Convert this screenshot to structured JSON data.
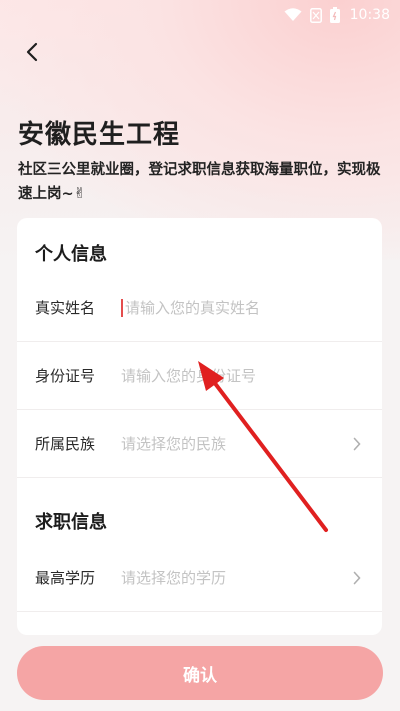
{
  "status_bar": {
    "time": "10:38",
    "icons": [
      "wifi-icon",
      "sim-icon",
      "battery-icon"
    ]
  },
  "nav": {
    "back_icon": "chevron-left-icon"
  },
  "header": {
    "title": "安徽民生工程",
    "subtitle": "社区三公里就业圈，登记求职信息获取海量职位，实现极速上岗~✌"
  },
  "personal_info": {
    "section_title": "个人信息",
    "fields": [
      {
        "label": "真实姓名",
        "placeholder": "请输入您的真实姓名",
        "type": "input"
      },
      {
        "label": "身份证号",
        "placeholder": "请输入您的身份证号",
        "type": "input"
      },
      {
        "label": "所属民族",
        "placeholder": "请选择您的民族",
        "type": "select"
      }
    ]
  },
  "job_info": {
    "section_title": "求职信息",
    "fields": [
      {
        "label": "最高学历",
        "placeholder": "请选择您的学历",
        "type": "select"
      }
    ]
  },
  "confirm": {
    "label": "确认"
  },
  "colors": {
    "accent": "#f5a5a5",
    "annotation_arrow": "#e02020",
    "caret": "#e44d4d"
  }
}
